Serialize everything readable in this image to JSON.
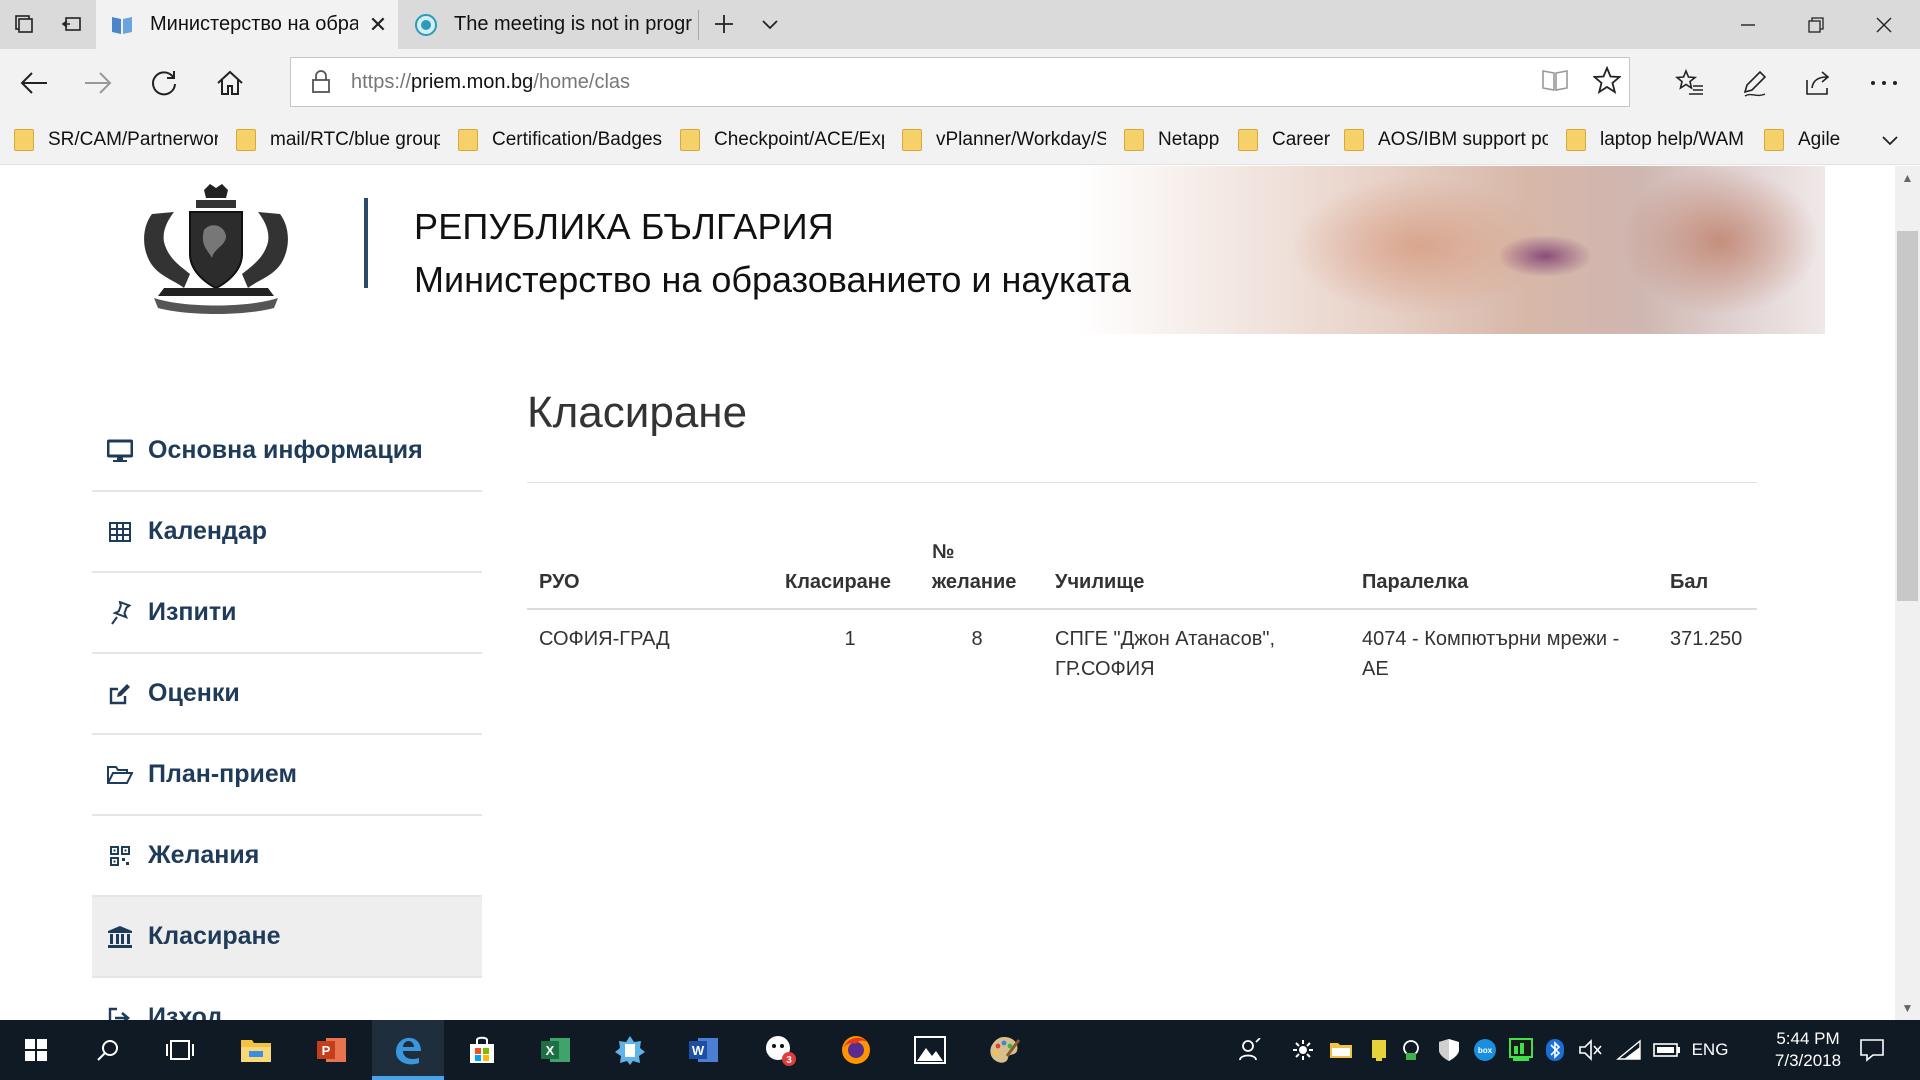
{
  "browser": {
    "tabs": [
      {
        "title": "Министерство на обра",
        "active": true
      },
      {
        "title": "The meeting is not in progr",
        "active": false
      }
    ],
    "address": {
      "scheme": "https://",
      "host": "priem.mon.bg",
      "path": "/home/clas"
    },
    "favorites": [
      "SR/CAM/Partnerworld",
      "mail/RTC/blue groups",
      "Certification/Badges/",
      "Checkpoint/ACE/Expe",
      "vPlanner/Workday/SF",
      "Netapp",
      "Career",
      "AOS/IBM support por",
      "laptop help/WAM",
      "Agile"
    ]
  },
  "header": {
    "republic": "РЕПУБЛИКА БЪЛГАРИЯ",
    "ministry": "Министерство на образованието и науката"
  },
  "sidebar": {
    "items": [
      {
        "label": "Основна информация",
        "icon": "monitor-icon"
      },
      {
        "label": "Календар",
        "icon": "calendar-grid-icon"
      },
      {
        "label": "Изпити",
        "icon": "pin-icon"
      },
      {
        "label": "Оценки",
        "icon": "edit-icon"
      },
      {
        "label": "План-прием",
        "icon": "folder-open-icon"
      },
      {
        "label": "Желания",
        "icon": "qrcode-icon"
      },
      {
        "label": "Класиране",
        "icon": "institution-icon",
        "active": true
      },
      {
        "label": "Изход",
        "icon": "logout-icon"
      }
    ]
  },
  "main": {
    "title": "Класиране",
    "table": {
      "headers": {
        "ruo": "РУО",
        "rank": "Класиране",
        "wish_no_1": "№",
        "wish_no_2": "желание",
        "school": "Училище",
        "class": "Паралелка",
        "score": "Бал"
      },
      "rows": [
        {
          "ruo": "СОФИЯ-ГРАД",
          "rank": "1",
          "wish": "8",
          "school_1": "СПГЕ \"Джон Атанасов\",",
          "school_2": "ГР.СОФИЯ",
          "class_1": "4074 - Компютърни мрежи -",
          "class_2": "АЕ",
          "score": "371.250"
        }
      ]
    }
  },
  "taskbar": {
    "time": "5:44 PM",
    "date": "7/3/2018",
    "language": "ENG",
    "badge_count": "3"
  },
  "colors": {
    "sidebar_text": "#1f3b5a",
    "taskbar": "#0f1a24",
    "accent": "#4aa3e6"
  }
}
